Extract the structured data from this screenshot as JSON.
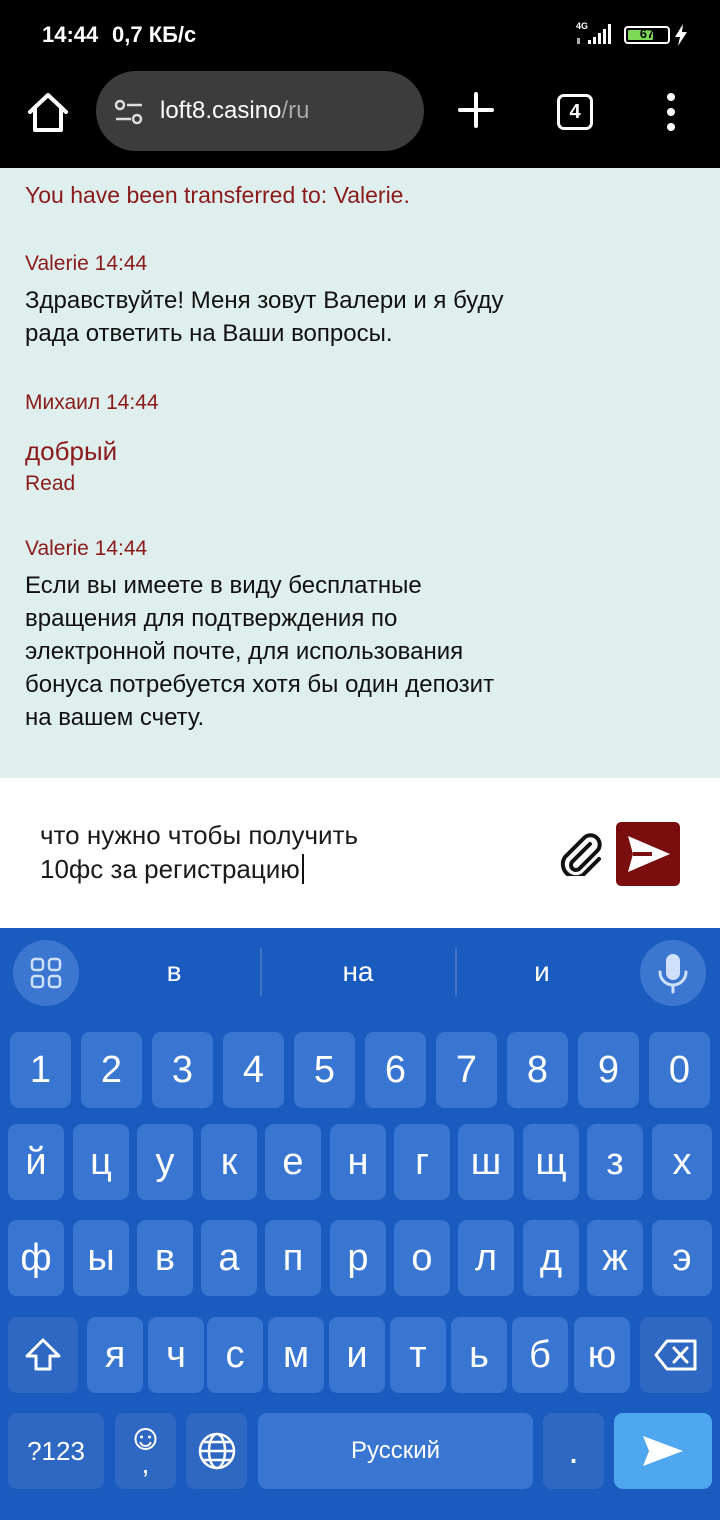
{
  "status_bar": {
    "time": "14:44",
    "speed": "0,7 КБ/с",
    "network": "4G",
    "battery": "67",
    "battery_level": 0.67
  },
  "browser": {
    "url_host": "loft8.casino",
    "url_path": "/ru",
    "tab_count": "4",
    "icons": [
      "home-icon",
      "site-settings-icon",
      "new-tab-icon",
      "tabs-icon",
      "more-icon"
    ]
  },
  "chat": {
    "system_message": "You have been transferred to: Valerie.",
    "messages": [
      {
        "meta": "Valerie 14:44",
        "lines": [
          "Здравствуйте! Меня зовут Валери и я буду",
          "рада ответить на Ваши вопросы."
        ]
      },
      {
        "meta": "Михаил 14:44",
        "text": "добрый",
        "status": "Read"
      },
      {
        "meta": "Valerie 14:44",
        "lines": [
          "Если вы имеете в виду бесплатные",
          "вращения для подтверждения по",
          "электронной почте, для использования",
          "бонуса потребуется хотя бы один депозит",
          "на вашем счету."
        ]
      }
    ]
  },
  "composer": {
    "lines": [
      "что нужно чтобы получить",
      "10фс за регистрацию"
    ]
  },
  "keyboard": {
    "suggestions": [
      "в",
      "на",
      "и"
    ],
    "rows": [
      [
        "1",
        "2",
        "3",
        "4",
        "5",
        "6",
        "7",
        "8",
        "9",
        "0"
      ],
      [
        "й",
        "ц",
        "у",
        "к",
        "е",
        "н",
        "г",
        "ш",
        "щ",
        "з",
        "х"
      ],
      [
        "ф",
        "ы",
        "в",
        "а",
        "п",
        "р",
        "о",
        "л",
        "д",
        "ж",
        "э"
      ],
      [
        "я",
        "ч",
        "с",
        "м",
        "и",
        "т",
        "ь",
        "б",
        "ю"
      ]
    ],
    "symbols_label": "?123",
    "comma": ",",
    "space_label": "Русский",
    "period": ".",
    "accent_color": "#1a5bbf"
  }
}
